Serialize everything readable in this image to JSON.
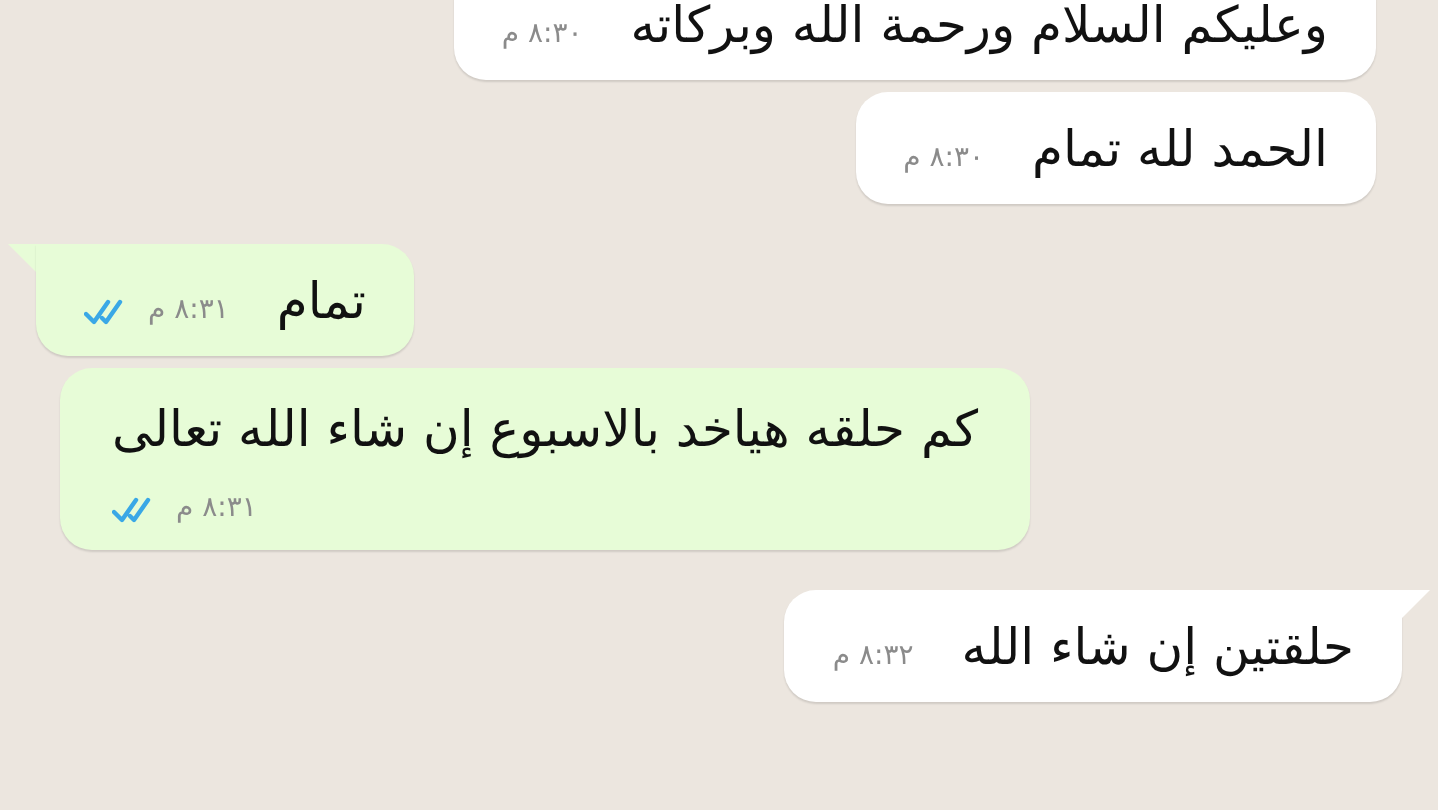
{
  "messages": [
    {
      "kind": "incoming",
      "tail": false,
      "time_below": false,
      "text": "وعليكم السلام ورحمة الله وبركاته",
      "time": "٨:٣٠ م"
    },
    {
      "kind": "incoming",
      "tail": false,
      "time_below": false,
      "text": "الحمد لله تمام",
      "time": "٨:٣٠ م"
    },
    {
      "kind": "outgoing",
      "tail": true,
      "time_below": false,
      "read": true,
      "text": "تمام",
      "time": "٨:٣١ م"
    },
    {
      "kind": "outgoing",
      "tail": false,
      "time_below": true,
      "read": true,
      "text": "كم حلقه هياخد بالاسبوع إن شاء الله تعالى",
      "time": "٨:٣١ م"
    },
    {
      "kind": "incoming",
      "tail": true,
      "time_below": false,
      "text": "حلقتين إن شاء الله",
      "time": "٨:٣٢ م"
    }
  ]
}
